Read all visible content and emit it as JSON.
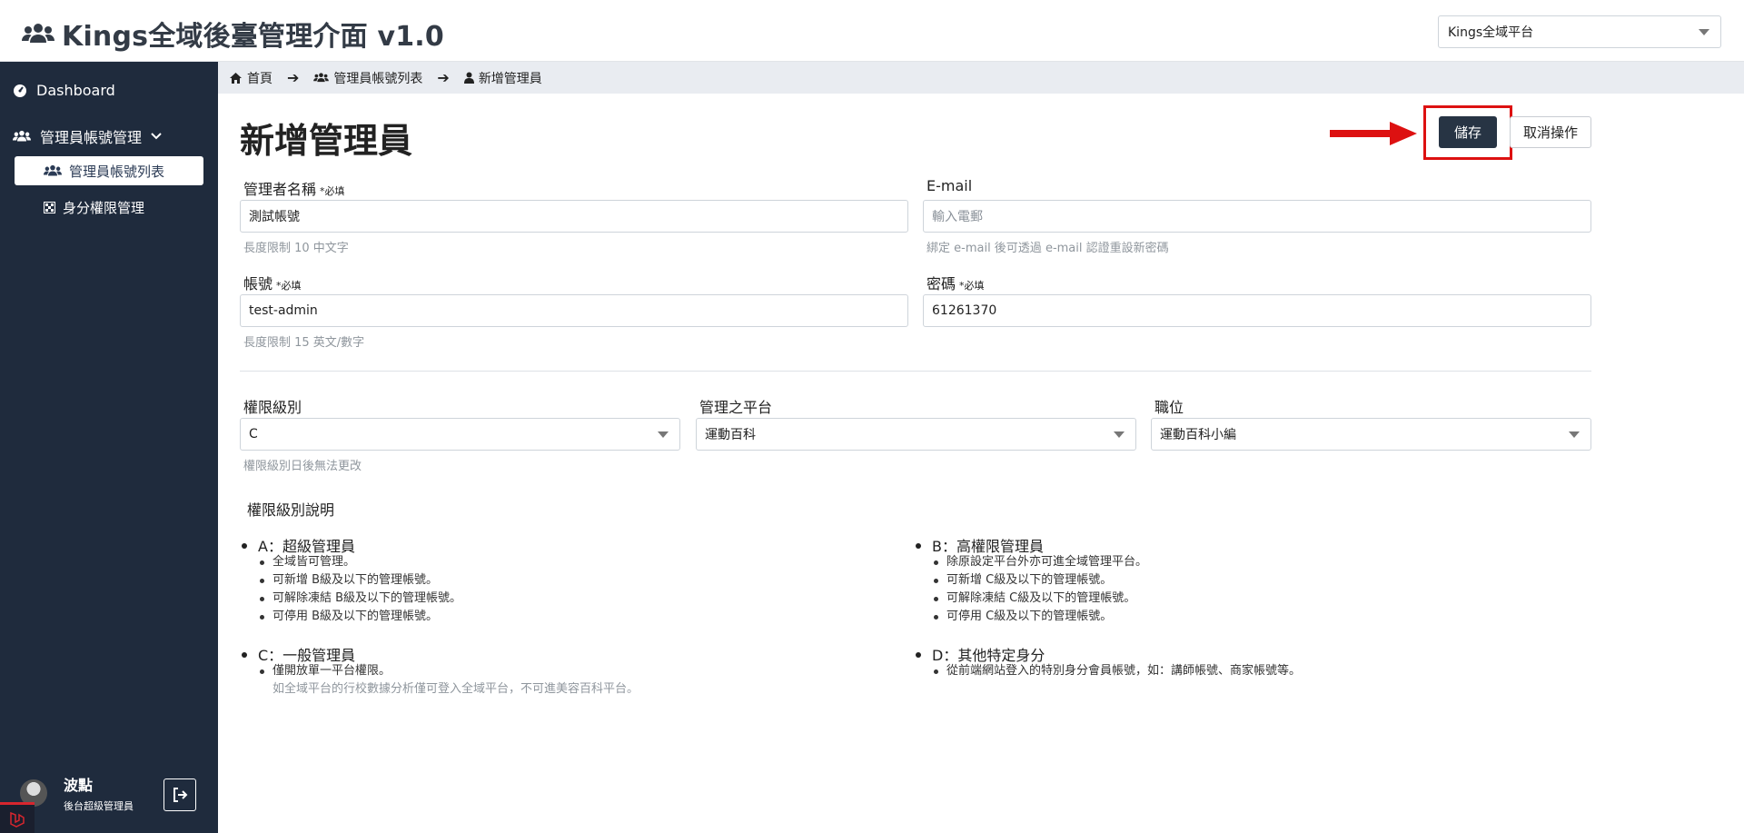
{
  "header": {
    "title": "Kings全域後臺管理介面 v1.0",
    "platform_select": "Kings全域平台"
  },
  "sidebar": {
    "dashboard": "Dashboard",
    "group": "管理員帳號管理",
    "active_item": "管理員帳號列表",
    "sub_item": "身分權限管理",
    "user": {
      "name": "波點",
      "role": "後台超級管理員"
    }
  },
  "breadcrumb": [
    "首頁",
    "管理員帳號列表",
    "新增管理員"
  ],
  "page": {
    "title": "新增管理員",
    "save_label": "儲存",
    "cancel_label": "取消操作"
  },
  "form": {
    "name": {
      "label": "管理者名稱",
      "required": "*必填",
      "value": "測試帳號",
      "hint": "長度限制 10 中文字"
    },
    "email": {
      "label": "E-mail",
      "placeholder": "輸入電郵",
      "hint": "綁定 e-mail 後可透過 e-mail 認證重設新密碼"
    },
    "account": {
      "label": "帳號",
      "required": "*必填",
      "value": "test-admin",
      "hint": "長度限制 15 英文/數字"
    },
    "password": {
      "label": "密碼",
      "required": "*必填",
      "value": "61261370"
    },
    "level": {
      "label": "權限級別",
      "value": "C",
      "hint": "權限級別日後無法更改"
    },
    "platform": {
      "label": "管理之平台",
      "value": "運動百科"
    },
    "position": {
      "label": "職位",
      "value": "運動百科小編"
    }
  },
  "levels_desc": {
    "title": "權限級別說明",
    "A": {
      "title": "A：超級管理員",
      "items": [
        "全域皆可管理。",
        "可新增 B級及以下的管理帳號。",
        "可解除凍結 B級及以下的管理帳號。",
        "可停用 B級及以下的管理帳號。"
      ]
    },
    "B": {
      "title": "B：高權限管理員",
      "items": [
        "除原設定平台外亦可進全域管理平台。",
        "可新增 C級及以下的管理帳號。",
        "可解除凍結 C級及以下的管理帳號。",
        "可停用 C級及以下的管理帳號。"
      ]
    },
    "C": {
      "title": "C：一般管理員",
      "items": [
        "僅開放單一平台權限。"
      ],
      "note": "如全域平台的行校數據分析僅可登入全域平台，不可進美容百科平台。"
    },
    "D": {
      "title": "D：其他特定身分",
      "items": [
        "從前端網站登入的特別身分會員帳號，如：講師帳號、商家帳號等。"
      ]
    }
  }
}
